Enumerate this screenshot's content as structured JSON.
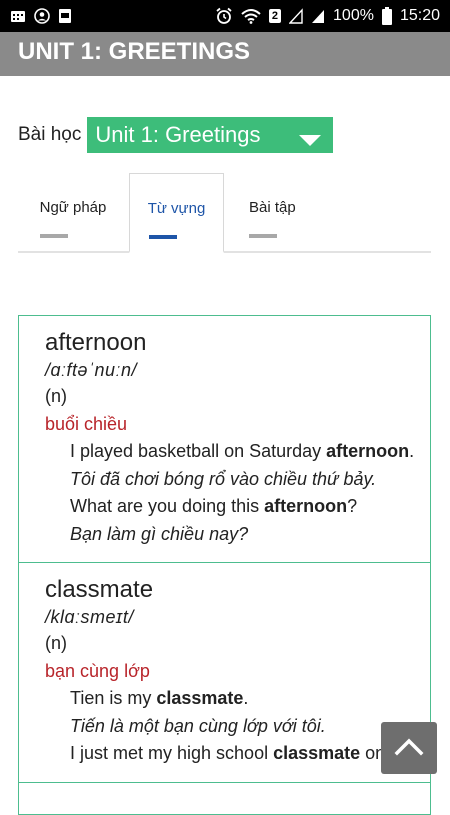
{
  "status_bar": {
    "battery_text": "100%",
    "time": "15:20",
    "sim_badge": "2",
    "icons": [
      "grid-icon",
      "account-icon",
      "storage-icon",
      "alarm-icon",
      "wifi-icon",
      "signal-icon",
      "signal-icon",
      "battery-icon"
    ]
  },
  "header": {
    "title": "UNIT 1: GREETINGS"
  },
  "lesson": {
    "label": "Bài học",
    "selected": "Unit 1: Greetings"
  },
  "tabs": [
    {
      "label": "Ngữ pháp",
      "active": false
    },
    {
      "label": "Từ vựng",
      "active": true
    },
    {
      "label": "Bài tập",
      "active": false
    }
  ],
  "entries": [
    {
      "word": "afternoon",
      "ipa": "/ɑːftəˈnuːn/",
      "pos": "(n)",
      "meaning": "buổi chiều",
      "examples": [
        {
          "en_before": "I played basketball on Saturday ",
          "en_bold": "afternoon",
          "en_after": ".",
          "vi": "Tôi đã chơi bóng rổ vào chiều thứ bảy."
        },
        {
          "en_before": "What are you doing this ",
          "en_bold": "afternoon",
          "en_after": "?",
          "vi": "Bạn làm gì chiều nay?"
        }
      ]
    },
    {
      "word": "classmate",
      "ipa": "/klɑːsmeɪt/",
      "pos": "(n)",
      "meaning": "bạn cùng lớp",
      "examples": [
        {
          "en_before": "Tien is my ",
          "en_bold": "classmate",
          "en_after": ".",
          "vi": "Tiến là một bạn cùng lớp với tôi."
        },
        {
          "en_before": "I just met my high school ",
          "en_bold": "classmate",
          "en_after": " on",
          "vi": ""
        }
      ]
    }
  ],
  "colors": {
    "accent_green": "#3dbd7a",
    "header_gray": "#8a8a8a",
    "meaning_red": "#b8242a",
    "tab_active_blue": "#1e55a8"
  }
}
